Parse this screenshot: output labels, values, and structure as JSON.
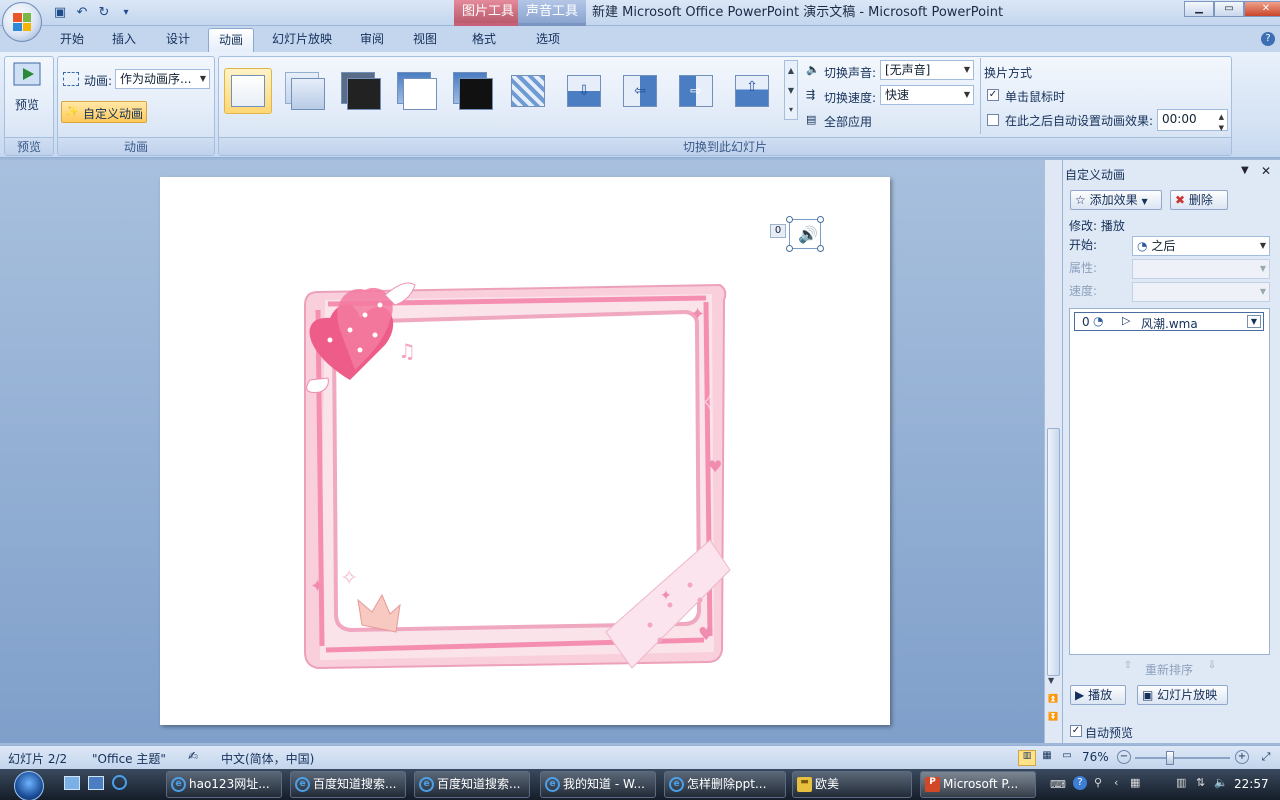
{
  "window": {
    "title": "新建 Microsoft Office PowerPoint 演示文稿 - Microsoft PowerPoint",
    "context_tab_picture": "图片工具",
    "context_tab_sound": "声音工具"
  },
  "tabs": [
    "开始",
    "插入",
    "设计",
    "动画",
    "幻灯片放映",
    "审阅",
    "视图",
    "格式",
    "选项"
  ],
  "ribbon": {
    "preview": {
      "button_label": "预览",
      "group_label": "预览"
    },
    "animations": {
      "anim_label": "动画:",
      "anim_value": "作为动画序...",
      "custom_anim_label": "自定义动画",
      "group_label": "动画"
    },
    "transition": {
      "group_label": "切换到此幻灯片",
      "sound_label": "切换声音:",
      "sound_value": "[无声音]",
      "speed_label": "切换速度:",
      "speed_value": "快速",
      "apply_all_label": "全部应用",
      "advance_title": "换片方式",
      "on_click_label": "单击鼠标时",
      "on_click_checked": true,
      "auto_after_label": "在此之后自动设置动画效果:",
      "auto_after_checked": false,
      "auto_after_value": "00:00"
    }
  },
  "slide": {
    "sound_badge": "0"
  },
  "task_pane": {
    "title": "自定义动画",
    "add_effect_label": "添加效果",
    "remove_label": "删除",
    "modify_label": "修改: 播放",
    "start_label": "开始:",
    "start_value": "之后",
    "property_label": "属性:",
    "speed_label": "速度:",
    "list_item": {
      "index": "0",
      "name": "风潮.wma"
    },
    "reorder_label": "重新排序",
    "play_label": "播放",
    "slideshow_label": "幻灯片放映",
    "autopreview_label": "自动预览",
    "autopreview_checked": true
  },
  "status": {
    "slide_counter": "幻灯片 2/2",
    "theme": "\"Office 主题\"",
    "language": "中文(简体，中国)",
    "zoom": "76%"
  },
  "taskbar": {
    "items": [
      "hao123网址...",
      "百度知道搜索...",
      "百度知道搜索...",
      "我的知道 - W...",
      "怎样删除ppt...",
      "欧美",
      "Microsoft P..."
    ],
    "clock": "22:57"
  }
}
